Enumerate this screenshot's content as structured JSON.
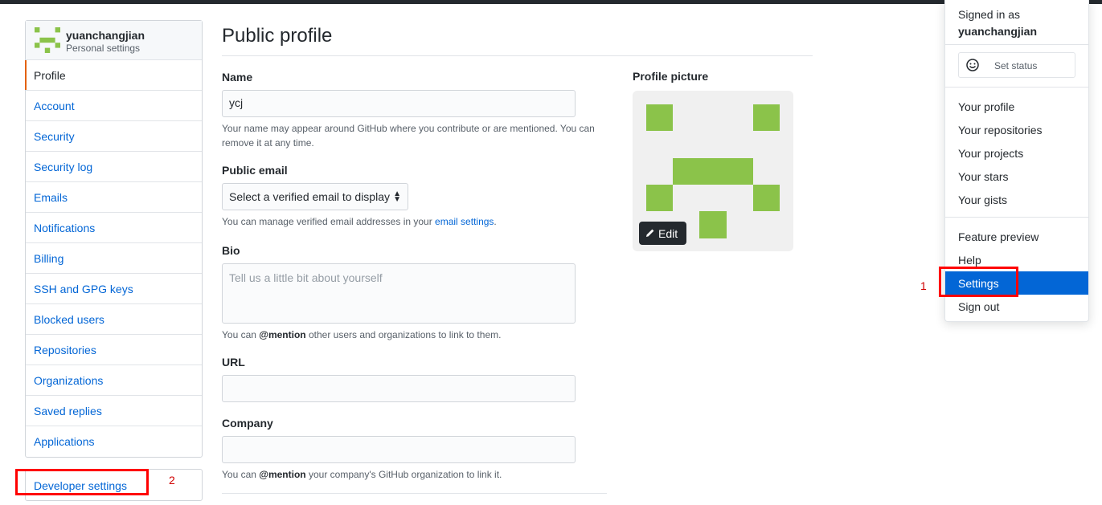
{
  "sidebar": {
    "username": "yuanchangjian",
    "subtitle": "Personal settings",
    "items": [
      {
        "label": "Profile"
      },
      {
        "label": "Account"
      },
      {
        "label": "Security"
      },
      {
        "label": "Security log"
      },
      {
        "label": "Emails"
      },
      {
        "label": "Notifications"
      },
      {
        "label": "Billing"
      },
      {
        "label": "SSH and GPG keys"
      },
      {
        "label": "Blocked users"
      },
      {
        "label": "Repositories"
      },
      {
        "label": "Organizations"
      },
      {
        "label": "Saved replies"
      },
      {
        "label": "Applications"
      }
    ],
    "developer_settings": "Developer settings"
  },
  "annotations": {
    "marker_1": "1",
    "marker_2": "2",
    "highlight_color": "#ff0000"
  },
  "main": {
    "title": "Public profile",
    "name_label": "Name",
    "name_value": "ycj",
    "name_note": "Your name may appear around GitHub where you contribute or are mentioned. You can remove it at any time.",
    "email_label": "Public email",
    "email_select": "Select a verified email to display",
    "email_note_prefix": "You can manage verified email addresses in your ",
    "email_note_link": "email settings",
    "email_note_suffix": ".",
    "bio_label": "Bio",
    "bio_placeholder": "Tell us a little bit about yourself",
    "bio_note_prefix": "You can ",
    "bio_note_mention": "@mention",
    "bio_note_suffix": " other users and organizations to link to them.",
    "url_label": "URL",
    "url_value": "",
    "company_label": "Company",
    "company_value": "",
    "company_note_prefix": "You can ",
    "company_note_mention": "@mention",
    "company_note_suffix": " your company's GitHub organization to link it.",
    "picture_label": "Profile picture",
    "edit_button": "Edit",
    "avatar_color": "#8bc34a"
  },
  "dropdown": {
    "signed_in_as": "Signed in as",
    "username": "yuanchangjian",
    "set_status": "Set status",
    "group1": [
      "Your profile",
      "Your repositories",
      "Your projects",
      "Your stars",
      "Your gists"
    ],
    "feature_preview": "Feature preview",
    "help": "Help",
    "settings": "Settings",
    "sign_out": "Sign out",
    "active_color": "#0366d6"
  }
}
